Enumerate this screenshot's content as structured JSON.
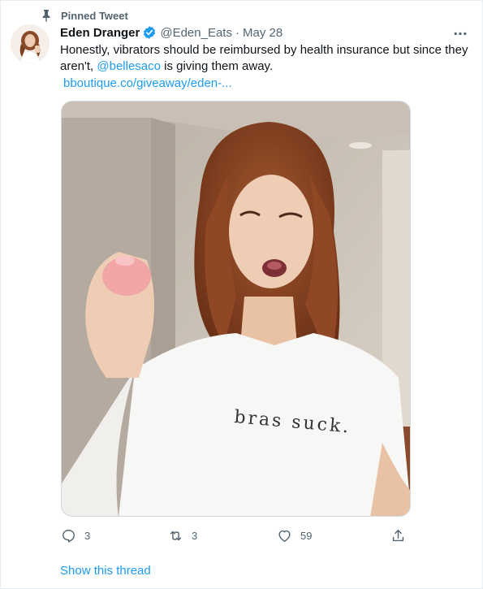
{
  "pinned": {
    "label": "Pinned Tweet",
    "icon": "pin-icon"
  },
  "author": {
    "display_name": "Eden Dranger",
    "handle": "@Eden_Eats",
    "separator": "·",
    "date": "May 28",
    "verified": true
  },
  "tweet": {
    "text_before_mention": "Honestly, vibrators should be reimbursed by health insurance but since they aren't, ",
    "mention": "@bellesaco",
    "text_after_mention": " is giving them away.",
    "link": "bboutique.co/giveaway/eden-..."
  },
  "media": {
    "shirt_text": "bras suck."
  },
  "actions": {
    "replies": "3",
    "retweets": "3",
    "likes": "59"
  },
  "show_thread_label": "Show this thread",
  "colors": {
    "accent": "#1d9bf0",
    "secondary_text": "#536471",
    "primary_text": "#0f1419"
  }
}
